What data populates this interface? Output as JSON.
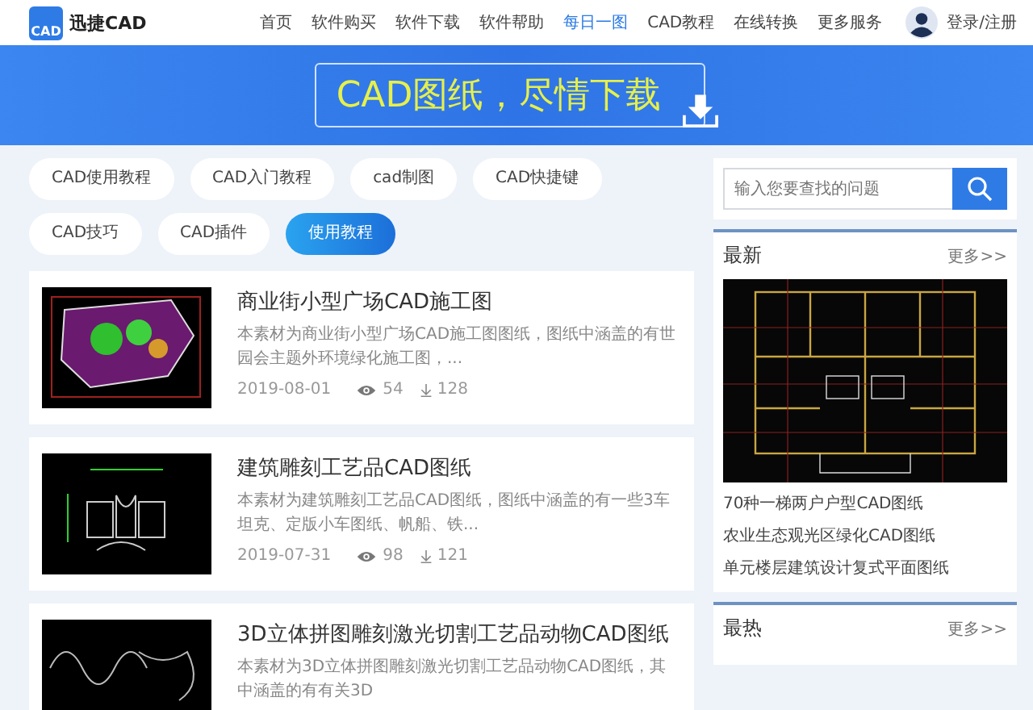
{
  "header": {
    "logo_text": "CAD",
    "brand": "迅捷CAD",
    "nav": [
      {
        "label": "首页",
        "selected": false
      },
      {
        "label": "软件购买",
        "selected": false
      },
      {
        "label": "软件下载",
        "selected": false
      },
      {
        "label": "软件帮助",
        "selected": false
      },
      {
        "label": "每日一图",
        "selected": true
      },
      {
        "label": "CAD教程",
        "selected": false
      },
      {
        "label": "在线转换",
        "selected": false
      },
      {
        "label": "更多服务",
        "selected": false
      }
    ],
    "login": "登录/注册"
  },
  "banner": {
    "title": "CAD图纸，尽情下载"
  },
  "tags": [
    {
      "label": "CAD使用教程",
      "selected": false
    },
    {
      "label": "CAD入门教程",
      "selected": false
    },
    {
      "label": "cad制图",
      "selected": false
    },
    {
      "label": "CAD快捷键",
      "selected": false
    },
    {
      "label": "CAD技巧",
      "selected": false
    },
    {
      "label": "CAD插件",
      "selected": false
    },
    {
      "label": "使用教程",
      "selected": true
    }
  ],
  "articles": [
    {
      "kind": "plan",
      "title": "商业街小型广场CAD施工图",
      "description": "本素材为商业街小型广场CAD施工图图纸，图纸中涵盖的有世园会主题外环境绿化施工图，...",
      "date": "2019-08-01",
      "views": "54",
      "downloads": "128"
    },
    {
      "kind": "sculpture",
      "title": "建筑雕刻工艺品CAD图纸",
      "description": "本素材为建筑雕刻工艺品CAD图纸，图纸中涵盖的有一些3车坦克、定版小车图纸、帆船、铁...",
      "date": "2019-07-31",
      "views": "98",
      "downloads": "121"
    },
    {
      "kind": "puzzle",
      "title": "3D立体拼图雕刻激光切割工艺品动物CAD图纸",
      "description": "本素材为3D立体拼图雕刻激光切割工艺品动物CAD图纸，其中涵盖的有有关3D"
    }
  ],
  "search": {
    "placeholder": "输入您要查找的问题"
  },
  "latest": {
    "title": "最新",
    "more": "更多>>",
    "links": [
      "70种一梯两户户型CAD图纸",
      "农业生态观光区绿化CAD图纸",
      "单元楼层建筑设计复式平面图纸"
    ]
  },
  "hottest": {
    "title": "最热",
    "more": "更多>>"
  }
}
